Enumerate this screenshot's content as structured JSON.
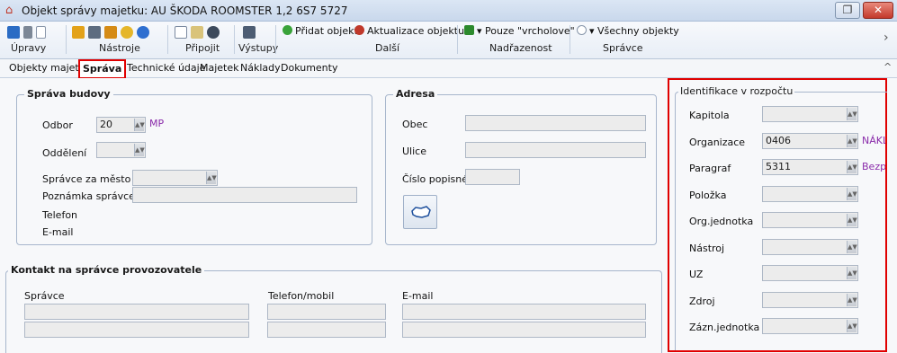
{
  "window": {
    "title": "Objekt správy majetku: AU ŠKODA ROOMSTER 1,2 6S7 5727",
    "restore_glyph": "❐",
    "close_glyph": "✕"
  },
  "ribbon": {
    "groups": {
      "upravy": "Úpravy",
      "nastroje": "Nástroje",
      "pripojit": "Připojit",
      "vystupy": "Výstupy",
      "dalsi": "Další",
      "nadrazenost": "Nadřazenost",
      "spravce": "Správce"
    },
    "buttons": {
      "pridat_objekt": "Přidat objekt",
      "aktualizace_objektu": "Aktualizace objektu",
      "pouze_vrcholove": "▾ Pouze \"vrcholove\"",
      "vsechny_objekty": "▾ Všechny objekty"
    },
    "colors": {
      "add": "#3aa33a",
      "update": "#c0392b",
      "tree": "#2d8a2d"
    }
  },
  "tabs": [
    "Objekty majetku",
    "Správa",
    "Technické údaje",
    "Majetek",
    "Náklady",
    "Dokumenty"
  ],
  "active_tab": "Správa",
  "sprava_budovy": {
    "legend": "Správa budovy",
    "odbor_label": "Odbor",
    "odbor_value": "20",
    "odbor_hint": "MP",
    "oddeleni_label": "Oddělení",
    "spravce_label": "Správce za město",
    "poznamka_label": "Poznámka správce",
    "telefon_label": "Telefon",
    "email_label": "E-mail"
  },
  "adresa": {
    "legend": "Adresa",
    "obec_label": "Obec",
    "ulice_label": "Ulice",
    "cislo_label": "Číslo popisné"
  },
  "kontakt": {
    "legend": "Kontakt na správce provozovatele",
    "col_spravce": "Správce",
    "col_telefon": "Telefon/mobil",
    "col_email": "E-mail"
  },
  "identifikace": {
    "title": "Identifikace v rozpočtu",
    "rows": [
      {
        "label": "Kapitola",
        "value": "",
        "hint": ""
      },
      {
        "label": "Organizace",
        "value": "0406",
        "hint": "NÁKL"
      },
      {
        "label": "Paragraf",
        "value": "5311",
        "hint": "Bezp"
      },
      {
        "label": "Položka",
        "value": "",
        "hint": ""
      },
      {
        "label": "Org.jednotka",
        "value": "",
        "hint": ""
      },
      {
        "label": "Nástroj",
        "value": "",
        "hint": ""
      },
      {
        "label": "UZ",
        "value": "",
        "hint": ""
      },
      {
        "label": "Zdroj",
        "value": "",
        "hint": ""
      },
      {
        "label": "Zázn.jednotka",
        "value": "",
        "hint": ""
      }
    ]
  }
}
